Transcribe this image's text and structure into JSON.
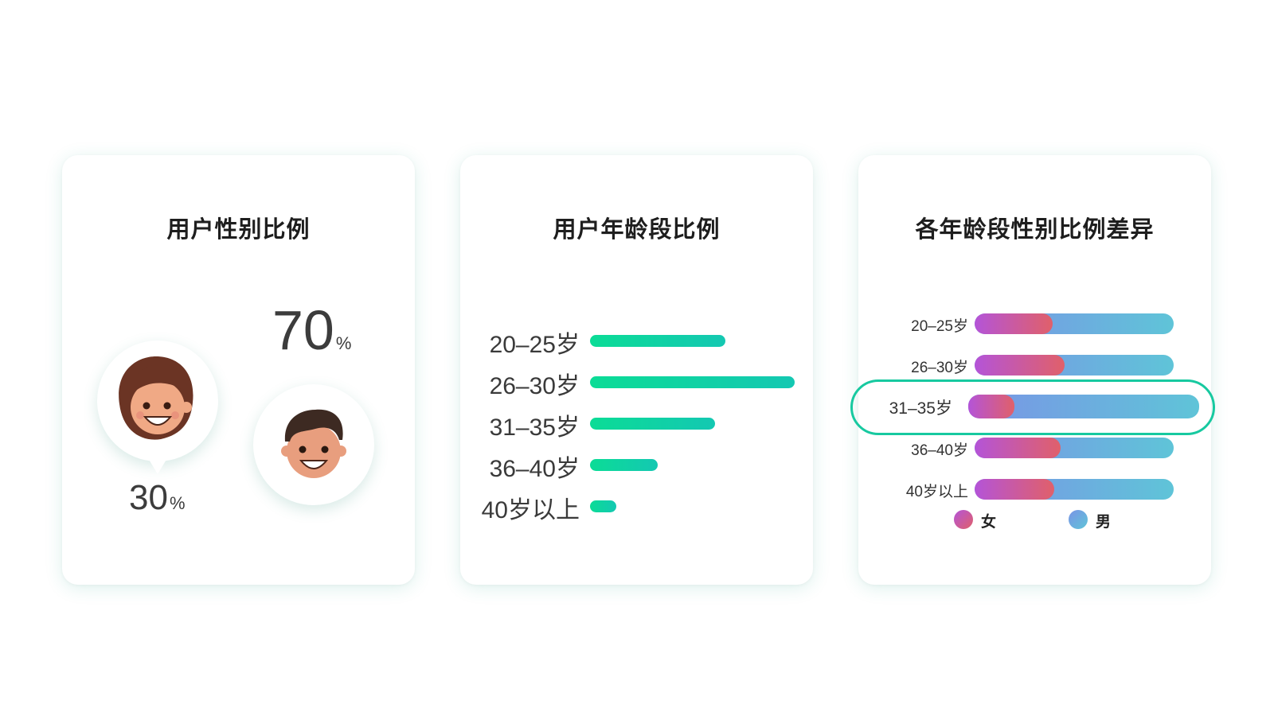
{
  "cards": {
    "gender": {
      "title": "用户性别比例"
    },
    "age": {
      "title": "用户年龄段比例"
    },
    "diff": {
      "title": "各年龄段性别比例差异"
    }
  },
  "gender": {
    "female": {
      "value": "30",
      "unit": "%",
      "icon": "female-avatar-icon"
    },
    "male": {
      "value": "70",
      "unit": "%",
      "icon": "male-avatar-icon"
    }
  },
  "chart_data": [
    {
      "type": "bar",
      "title": "用户性别比例",
      "categories": [
        "女",
        "男"
      ],
      "values": [
        30,
        70
      ]
    },
    {
      "type": "bar",
      "orientation": "horizontal",
      "title": "用户年龄段比例",
      "categories": [
        "20–25岁",
        "26–30岁",
        "31–35岁",
        "36–40岁",
        "40岁以上"
      ],
      "values": [
        66,
        100,
        61,
        33,
        13
      ],
      "colors": [
        "#0bdc96",
        "#14c8b2"
      ]
    },
    {
      "type": "bar",
      "stacked": true,
      "orientation": "horizontal",
      "title": "各年龄段性别比例差异",
      "categories": [
        "20–25岁",
        "26–30岁",
        "31–35岁",
        "36–40岁",
        "40岁以上"
      ],
      "highlighted_category": "31–35岁",
      "series": [
        {
          "name": "女",
          "values": [
            39,
            45,
            20,
            43,
            40
          ],
          "color": "#c058c8"
        },
        {
          "name": "男",
          "values": [
            61,
            55,
            80,
            57,
            60
          ],
          "color": "#6aa8e0"
        }
      ],
      "legend_position": "bottom"
    }
  ]
}
